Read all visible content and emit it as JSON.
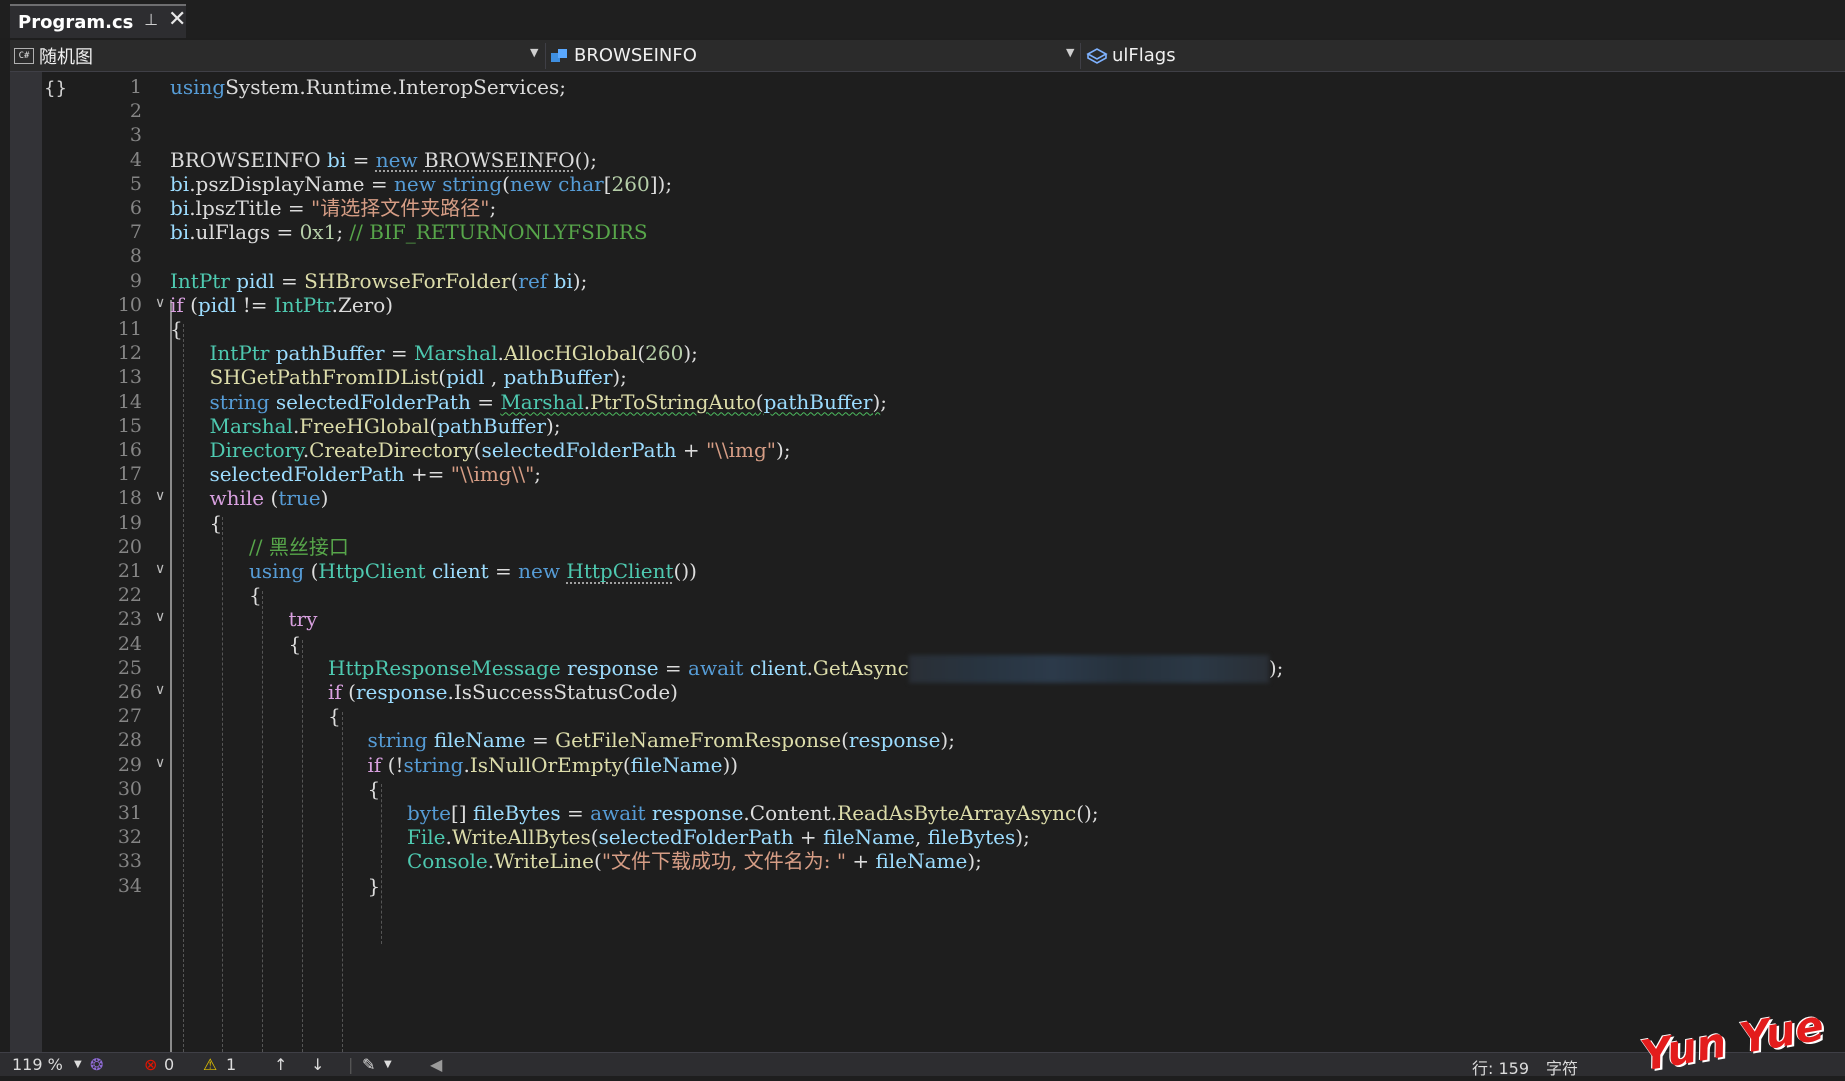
{
  "tab": {
    "title": "Program.cs",
    "pin_glyph": "⊣",
    "close_glyph": "✕"
  },
  "navbar": {
    "project": "随机图",
    "project_icon": "C#",
    "type": "BROWSEINFO",
    "member": "ulFlags"
  },
  "editor": {
    "lines": [
      {
        "n": "1",
        "fold": "",
        "segs": [
          [
            "kw",
            "using"
          ],
          [
            "",
            "System.Runtime.InteropServices;"
          ]
        ]
      },
      {
        "n": "2",
        "fold": "",
        "segs": []
      },
      {
        "n": "3",
        "fold": "",
        "segs": []
      },
      {
        "n": "4",
        "fold": "",
        "segs": [
          [
            "",
            "BROWSEINFO "
          ],
          [
            "var",
            "bi"
          ],
          [
            "",
            " = "
          ],
          [
            "kw dots",
            "new"
          ],
          [
            "",
            " "
          ],
          [
            "dots",
            "BROWSEINFO"
          ],
          [
            "",
            "();"
          ]
        ]
      },
      {
        "n": "5",
        "fold": "",
        "segs": [
          [
            "var",
            "bi"
          ],
          [
            "",
            ".pszDisplayName = "
          ],
          [
            "kw",
            "new"
          ],
          [
            "",
            " "
          ],
          [
            "kw",
            "string"
          ],
          [
            "",
            "("
          ],
          [
            "kw",
            "new"
          ],
          [
            "",
            " "
          ],
          [
            "kw",
            "char"
          ],
          [
            "",
            "["
          ],
          [
            "num",
            "260"
          ],
          [
            "",
            "]);"
          ]
        ]
      },
      {
        "n": "6",
        "fold": "",
        "segs": [
          [
            "var",
            "bi"
          ],
          [
            "",
            ".lpszTitle = "
          ],
          [
            "str",
            "\"请选择文件夹路径\""
          ],
          [
            "",
            ";"
          ]
        ]
      },
      {
        "n": "7",
        "fold": "",
        "segs": [
          [
            "var",
            "bi"
          ],
          [
            "",
            ".ulFlags = "
          ],
          [
            "num",
            "0x1"
          ],
          [
            "",
            "; "
          ],
          [
            "com",
            "// BIF_RETURNONLYFSDIRS"
          ]
        ]
      },
      {
        "n": "8",
        "fold": "",
        "segs": []
      },
      {
        "n": "9",
        "fold": "",
        "segs": [
          [
            "typ",
            "IntPtr"
          ],
          [
            "",
            " "
          ],
          [
            "var",
            "pidl"
          ],
          [
            "",
            " = "
          ],
          [
            "mth",
            "SHBrowseForFolder"
          ],
          [
            "",
            "("
          ],
          [
            "kw",
            "ref"
          ],
          [
            "",
            " "
          ],
          [
            "var",
            "bi"
          ],
          [
            "",
            ");"
          ]
        ]
      },
      {
        "n": "10",
        "fold": "⌄",
        "segs": [
          [
            "ctl",
            "if"
          ],
          [
            "",
            " ("
          ],
          [
            "var",
            "pidl"
          ],
          [
            "",
            " != "
          ],
          [
            "typ",
            "IntPtr"
          ],
          [
            "",
            ".Zero)"
          ]
        ]
      },
      {
        "n": "11",
        "fold": "",
        "segs": [
          [
            "",
            "{"
          ]
        ]
      },
      {
        "n": "12",
        "fold": "",
        "indent": 1,
        "segs": [
          [
            "typ",
            "IntPtr"
          ],
          [
            "",
            " "
          ],
          [
            "var",
            "pathBuffer"
          ],
          [
            "",
            " = "
          ],
          [
            "typ",
            "Marshal"
          ],
          [
            "",
            "."
          ],
          [
            "mth",
            "AllocHGlobal"
          ],
          [
            "",
            "("
          ],
          [
            "num",
            "260"
          ],
          [
            "",
            ");"
          ]
        ]
      },
      {
        "n": "13",
        "fold": "",
        "indent": 1,
        "segs": [
          [
            "mth",
            "SHGetPathFromIDList"
          ],
          [
            "",
            "("
          ],
          [
            "var",
            "pidl"
          ],
          [
            "",
            " , "
          ],
          [
            "var",
            "pathBuffer"
          ],
          [
            "",
            ");"
          ]
        ]
      },
      {
        "n": "14",
        "fold": "",
        "indent": 1,
        "segs": [
          [
            "kw",
            "string"
          ],
          [
            "",
            " "
          ],
          [
            "var",
            "selectedFolderPath"
          ],
          [
            "",
            " = "
          ],
          [
            "typ squig",
            "Marshal"
          ],
          [
            "squig",
            "."
          ],
          [
            "mth squig",
            "PtrToStringAuto"
          ],
          [
            "squig",
            "("
          ],
          [
            "var squig",
            "pathBuffer"
          ],
          [
            "squig",
            ")"
          ],
          [
            "",
            ";"
          ]
        ]
      },
      {
        "n": "15",
        "fold": "",
        "indent": 1,
        "segs": [
          [
            "typ",
            "Marshal"
          ],
          [
            "",
            "."
          ],
          [
            "mth",
            "FreeHGlobal"
          ],
          [
            "",
            "("
          ],
          [
            "var",
            "pathBuffer"
          ],
          [
            "",
            ");"
          ]
        ]
      },
      {
        "n": "16",
        "fold": "",
        "indent": 1,
        "segs": [
          [
            "typ",
            "Directory"
          ],
          [
            "",
            "."
          ],
          [
            "mth",
            "CreateDirectory"
          ],
          [
            "",
            "("
          ],
          [
            "var",
            "selectedFolderPath"
          ],
          [
            "",
            " + "
          ],
          [
            "str",
            "\"\\\\img\""
          ],
          [
            "",
            ");"
          ]
        ]
      },
      {
        "n": "17",
        "fold": "",
        "indent": 1,
        "segs": [
          [
            "var",
            "selectedFolderPath"
          ],
          [
            "",
            " += "
          ],
          [
            "str",
            "\"\\\\img\\\\\""
          ],
          [
            "",
            ";"
          ]
        ]
      },
      {
        "n": "18",
        "fold": "⌄",
        "indent": 1,
        "segs": [
          [
            "ctl",
            "while"
          ],
          [
            "",
            " ("
          ],
          [
            "kw",
            "true"
          ],
          [
            "",
            ")"
          ]
        ]
      },
      {
        "n": "19",
        "fold": "",
        "indent": 1,
        "segs": [
          [
            "",
            "{"
          ]
        ]
      },
      {
        "n": "20",
        "fold": "",
        "indent": 2,
        "segs": [
          [
            "com",
            "// 黑丝接口"
          ]
        ]
      },
      {
        "n": "21",
        "fold": "⌄",
        "indent": 2,
        "segs": [
          [
            "kw",
            "using"
          ],
          [
            "",
            " ("
          ],
          [
            "typ",
            "HttpClient"
          ],
          [
            "",
            " "
          ],
          [
            "var",
            "client"
          ],
          [
            "",
            " = "
          ],
          [
            "kw",
            "new"
          ],
          [
            "",
            " "
          ],
          [
            "typ dots",
            "HttpClient"
          ],
          [
            "",
            "())"
          ]
        ]
      },
      {
        "n": "22",
        "fold": "",
        "indent": 2,
        "segs": [
          [
            "",
            "{"
          ]
        ]
      },
      {
        "n": "23",
        "fold": "⌄",
        "indent": 3,
        "segs": [
          [
            "ctl",
            "try"
          ]
        ]
      },
      {
        "n": "24",
        "fold": "",
        "indent": 3,
        "segs": [
          [
            "",
            "{"
          ]
        ]
      },
      {
        "n": "25",
        "fold": "",
        "indent": 4,
        "segs": [
          [
            "typ",
            "HttpResponseMessage"
          ],
          [
            "",
            " "
          ],
          [
            "var",
            "response"
          ],
          [
            "",
            " = "
          ],
          [
            "kw",
            "await"
          ],
          [
            "",
            " "
          ],
          [
            "var",
            "client"
          ],
          [
            "",
            "."
          ],
          [
            "mth",
            "GetAsync"
          ],
          [
            "blur",
            ""
          ],
          [
            "",
            ");"
          ]
        ]
      },
      {
        "n": "26",
        "fold": "⌄",
        "indent": 4,
        "segs": [
          [
            "ctl",
            "if"
          ],
          [
            "",
            " ("
          ],
          [
            "var",
            "response"
          ],
          [
            "",
            ".IsSuccessStatusCode)"
          ]
        ]
      },
      {
        "n": "27",
        "fold": "",
        "indent": 4,
        "segs": [
          [
            "",
            "{"
          ]
        ]
      },
      {
        "n": "28",
        "fold": "",
        "indent": 5,
        "segs": [
          [
            "kw",
            "string"
          ],
          [
            "",
            " "
          ],
          [
            "var",
            "fileName"
          ],
          [
            "",
            " = "
          ],
          [
            "mth",
            "GetFileNameFromResponse"
          ],
          [
            "",
            "("
          ],
          [
            "var",
            "response"
          ],
          [
            "",
            ");"
          ]
        ]
      },
      {
        "n": "29",
        "fold": "⌄",
        "indent": 5,
        "segs": [
          [
            "ctl",
            "if"
          ],
          [
            "",
            " (!"
          ],
          [
            "kw",
            "string"
          ],
          [
            "",
            "."
          ],
          [
            "mth",
            "IsNullOrEmpty"
          ],
          [
            "",
            "("
          ],
          [
            "var",
            "fileName"
          ],
          [
            "",
            "))"
          ]
        ]
      },
      {
        "n": "30",
        "fold": "",
        "indent": 5,
        "segs": [
          [
            "",
            "{"
          ]
        ]
      },
      {
        "n": "31",
        "fold": "",
        "indent": 6,
        "segs": [
          [
            "kw",
            "byte"
          ],
          [
            "",
            "[] "
          ],
          [
            "var",
            "fileBytes"
          ],
          [
            "",
            " = "
          ],
          [
            "kw",
            "await"
          ],
          [
            "",
            " "
          ],
          [
            "var",
            "response"
          ],
          [
            "",
            ".Content."
          ],
          [
            "mth",
            "ReadAsByteArrayAsync"
          ],
          [
            "",
            "();"
          ]
        ]
      },
      {
        "n": "32",
        "fold": "",
        "indent": 6,
        "segs": [
          [
            "typ",
            "File"
          ],
          [
            "",
            "."
          ],
          [
            "mth",
            "WriteAllBytes"
          ],
          [
            "",
            "("
          ],
          [
            "var",
            "selectedFolderPath"
          ],
          [
            "",
            " + "
          ],
          [
            "var",
            "fileName"
          ],
          [
            "",
            ", "
          ],
          [
            "var",
            "fileBytes"
          ],
          [
            "",
            ");"
          ]
        ]
      },
      {
        "n": "33",
        "fold": "",
        "indent": 6,
        "segs": [
          [
            "typ",
            "Console"
          ],
          [
            "",
            "."
          ],
          [
            "mth",
            "WriteLine"
          ],
          [
            "",
            "("
          ],
          [
            "str",
            "\"文件下载成功, 文件名为: \""
          ],
          [
            "",
            " + "
          ],
          [
            "var",
            "fileName"
          ],
          [
            "",
            ");"
          ]
        ]
      },
      {
        "n": "34",
        "fold": "",
        "indent": 5,
        "segs": [
          [
            "",
            "}"
          ]
        ]
      }
    ]
  },
  "statusbar": {
    "zoom": "119 %",
    "errors": "0",
    "warnings": "1",
    "position": "行: 159",
    "encoding": "字符"
  },
  "watermark": {
    "text": "Yun Yue"
  },
  "colors": {
    "keyword": "#569cd6",
    "control": "#d8a0df",
    "type": "#4ec9b0",
    "method": "#dcdcaa",
    "variable": "#9cdcfe",
    "string": "#d69d85",
    "number": "#b5cea8",
    "comment": "#57a64a"
  }
}
